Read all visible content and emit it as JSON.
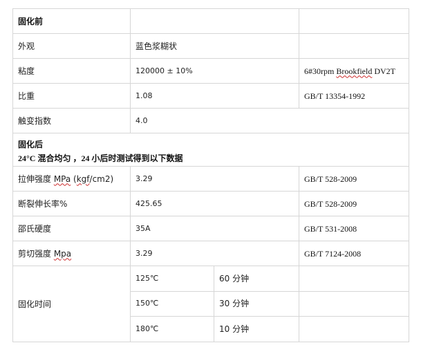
{
  "before_cure": {
    "heading": "固化前",
    "rows": [
      {
        "label": "外观",
        "value": "蓝色浆糊状",
        "method": ""
      },
      {
        "label": "粘度",
        "value": "120000 ± 10%",
        "method_prefix": "6#30rpm ",
        "method_spell": "Brookfield",
        "method_suffix": " DV2T"
      },
      {
        "label": "比重",
        "value": "1.08",
        "method": "GB/T 13354-1992"
      },
      {
        "label": "触变指数",
        "value": "4.0"
      }
    ]
  },
  "after_cure": {
    "heading": "固化后",
    "condition": "24°C  混合均匀 ，24 小后时测试得到以下数据",
    "rows": [
      {
        "label_prefix": "拉伸强度 ",
        "label_spell": "MPa",
        "label_mid": " (",
        "label_spell2": "kgf",
        "label_suffix": "/cm2)",
        "value": "3.29",
        "method": "GB/T 528-2009"
      },
      {
        "label": "断裂伸长率%",
        "value": "425.65",
        "method": "GB/T 528-2009"
      },
      {
        "label": "邵氏硬度",
        "value": "35A",
        "method": "GB/T 531-2008"
      },
      {
        "label_prefix": "剪切强度 ",
        "label_spell": "Mpa",
        "value": "3.29",
        "method": "GB/T 7124-2008"
      }
    ],
    "cure_time": {
      "label": "固化时间",
      "rows": [
        {
          "temp": "125℃",
          "time": "60 分钟"
        },
        {
          "temp": "150℃",
          "time": "30 分钟"
        },
        {
          "temp": "180℃",
          "time": "10 分钟"
        }
      ]
    }
  }
}
